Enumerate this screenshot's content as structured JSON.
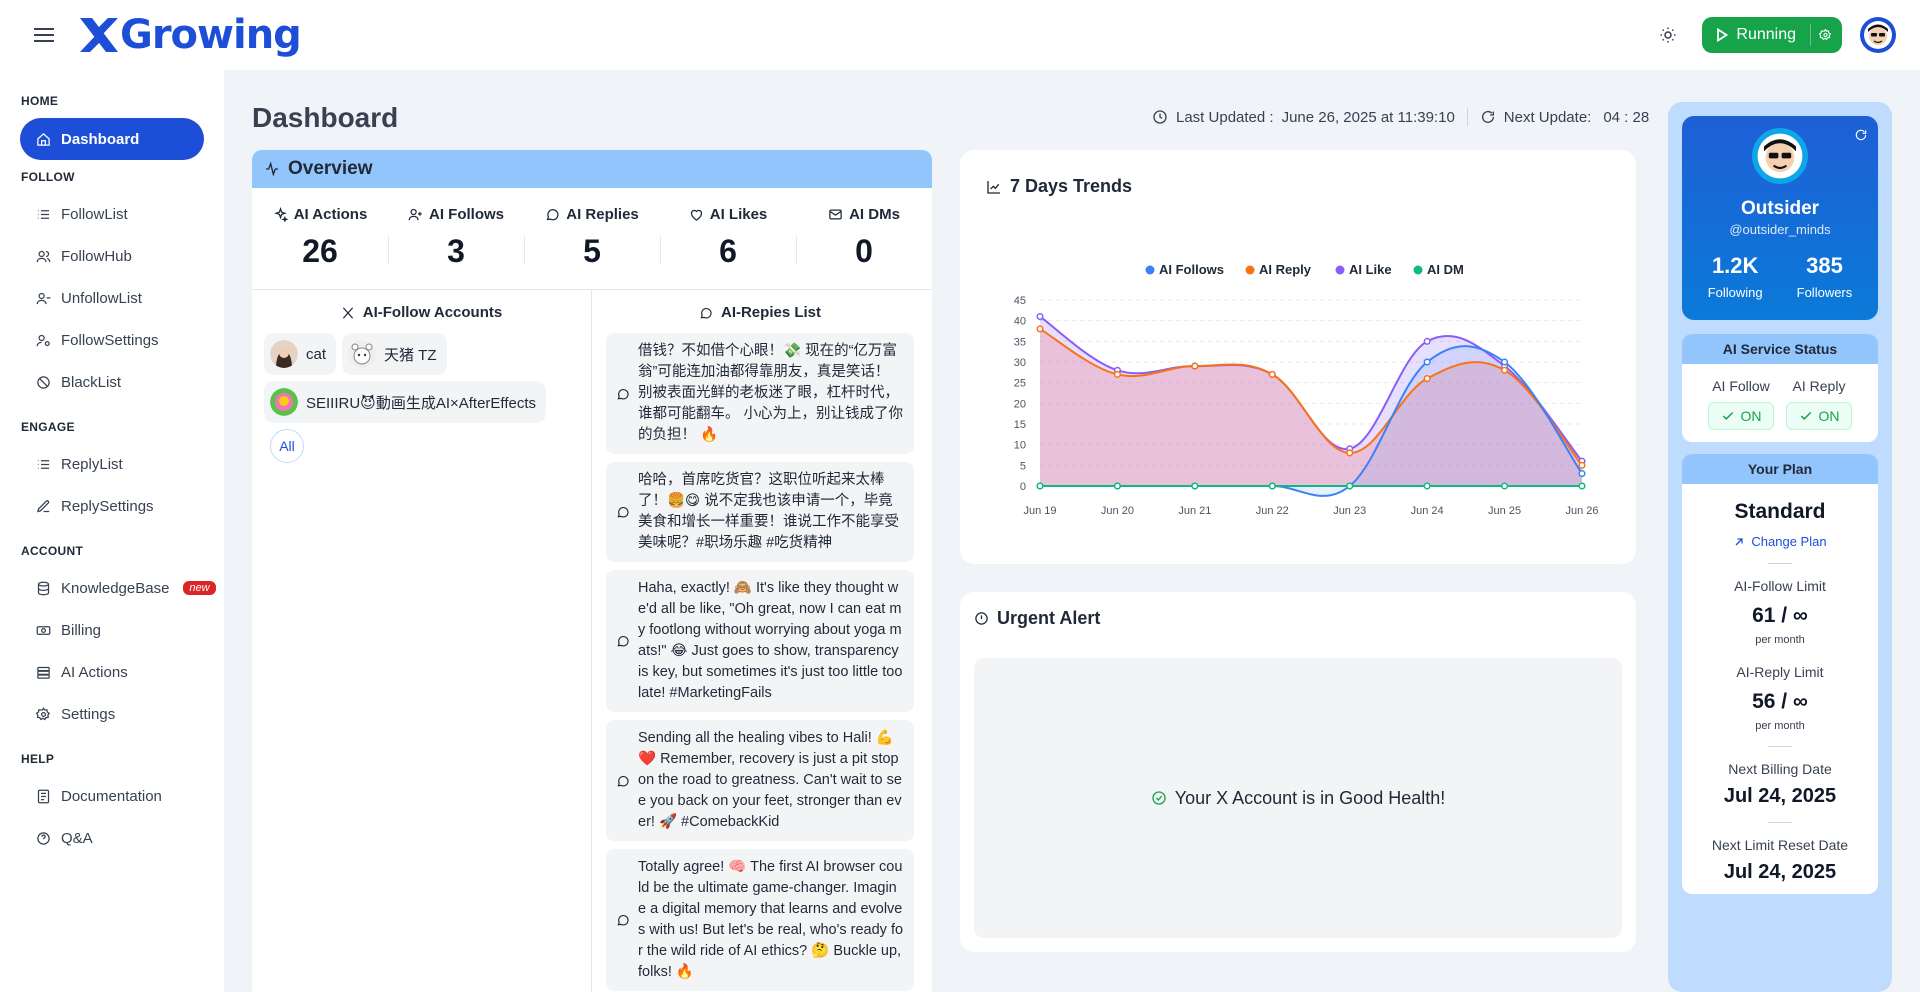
{
  "brand": {
    "name": "Growing"
  },
  "topbar": {
    "status": "Running"
  },
  "sidebar": {
    "sections": [
      {
        "title": "HOME",
        "items": [
          {
            "label": "Dashboard"
          }
        ]
      },
      {
        "title": "FOLLOW",
        "items": [
          {
            "label": "FollowList"
          },
          {
            "label": "FollowHub"
          },
          {
            "label": "UnfollowList"
          },
          {
            "label": "FollowSettings"
          },
          {
            "label": "BlackList"
          }
        ]
      },
      {
        "title": "ENGAGE",
        "items": [
          {
            "label": "ReplyList"
          },
          {
            "label": "ReplySettings"
          }
        ]
      },
      {
        "title": "ACCOUNT",
        "items": [
          {
            "label": "KnowledgeBase",
            "badge": "new"
          },
          {
            "label": "Billing"
          },
          {
            "label": "AI Actions"
          },
          {
            "label": "Settings"
          }
        ]
      },
      {
        "title": "HELP",
        "items": [
          {
            "label": "Documentation"
          },
          {
            "label": "Q&A"
          }
        ]
      }
    ]
  },
  "header": {
    "title": "Dashboard",
    "last_updated_label": "Last Updated :",
    "last_updated": "June 26, 2025 at 11:39:10",
    "next_update_label": "Next Update:",
    "next_update": "04 : 28"
  },
  "overview": {
    "title": "Overview",
    "stats": [
      {
        "label": "AI Actions",
        "value": "26"
      },
      {
        "label": "AI Follows",
        "value": "3"
      },
      {
        "label": "AI Replies",
        "value": "5"
      },
      {
        "label": "AI Likes",
        "value": "6"
      },
      {
        "label": "AI DMs",
        "value": "0"
      }
    ],
    "follow_title": "AI-Follow Accounts",
    "accounts": [
      {
        "name": "cat"
      },
      {
        "name": "天猪 TZ"
      },
      {
        "name": "SEIIIRU😈動画生成AI×AfterEffects"
      }
    ],
    "all_label": "All",
    "replies_title": "AI-Repies List",
    "replies": [
      "借钱？不如借个心眼！💸 现在的“亿万富翁”可能连加油都得靠朋友，真是笑话！ 别被表面光鲜的老板迷了眼，杠杆时代，谁都可能翻车。 小心为上，别让钱成了你的负担！ 🔥",
      "哈哈，首席吃货官？这职位听起来太棒了！🍔😋 说不定我也该申请一个，毕竟美食和增长一样重要！谁说工作不能享受美味呢？#职场乐趣 #吃货精神",
      "Haha, exactly! 🙈 It's like they thought we'd all be like, \"Oh great, now I can eat my footlong without worrying about yoga mats!\" 😂 Just goes to show, transparency is key, but sometimes it's just too little too late! #MarketingFails",
      "Sending all the healing vibes to Hali! 💪❤️ Remember, recovery is just a pit stop on the road to greatness. Can't wait to see you back on your feet, stronger than ever! 🚀 #ComebackKid",
      "Totally agree! 🧠 The first AI browser could be the ultimate game-changer. Imagine a digital memory that learns and evolves with us! But let's be real, who's ready for the wild ride of AI ethics? 🤔 Buckle up, folks! 🔥"
    ]
  },
  "trends": {
    "title": "7 Days Trends"
  },
  "chart_data": {
    "type": "area",
    "categories": [
      "Jun 19",
      "Jun 20",
      "Jun 21",
      "Jun 22",
      "Jun 23",
      "Jun 24",
      "Jun 25",
      "Jun 26"
    ],
    "series": [
      {
        "name": "AI Follows",
        "color": "#3b82f6",
        "values": [
          0,
          0,
          0,
          0,
          0,
          30,
          30,
          3
        ]
      },
      {
        "name": "AI Reply",
        "color": "#f97316",
        "values": [
          38,
          27,
          29,
          27,
          8,
          26,
          28,
          5
        ]
      },
      {
        "name": "AI Like",
        "color": "#8b5cf6",
        "values": [
          41,
          28,
          29,
          27,
          9,
          35,
          29,
          6
        ]
      },
      {
        "name": "AI DM",
        "color": "#10b981",
        "values": [
          0,
          0,
          0,
          0,
          0,
          0,
          0,
          0
        ]
      }
    ],
    "yticks": [
      0,
      5,
      10,
      15,
      20,
      25,
      30,
      35,
      40,
      45
    ],
    "ylim": [
      0,
      45
    ],
    "legend": "top"
  },
  "urgent": {
    "title": "Urgent Alert",
    "message": "Your X Account is in Good Health!"
  },
  "profile": {
    "name": "Outsider",
    "handle": "@outsider_minds",
    "following": "1.2K",
    "following_label": "Following",
    "followers": "385",
    "followers_label": "Followers"
  },
  "service": {
    "title": "AI Service Status",
    "items": [
      {
        "label": "AI Follow",
        "state": "ON"
      },
      {
        "label": "AI Reply",
        "state": "ON"
      }
    ]
  },
  "plan": {
    "title": "Your Plan",
    "name": "Standard",
    "change_label": "Change Plan",
    "follow_limit_label": "AI-Follow Limit",
    "follow_limit": "61 / ∞",
    "per_month": "per month",
    "reply_limit_label": "AI-Reply Limit",
    "reply_limit": "56 / ∞",
    "billing_label": "Next Billing Date",
    "billing_date": "Jul 24, 2025",
    "reset_label": "Next Limit Reset Date",
    "reset_date": "Jul 24, 2025"
  }
}
